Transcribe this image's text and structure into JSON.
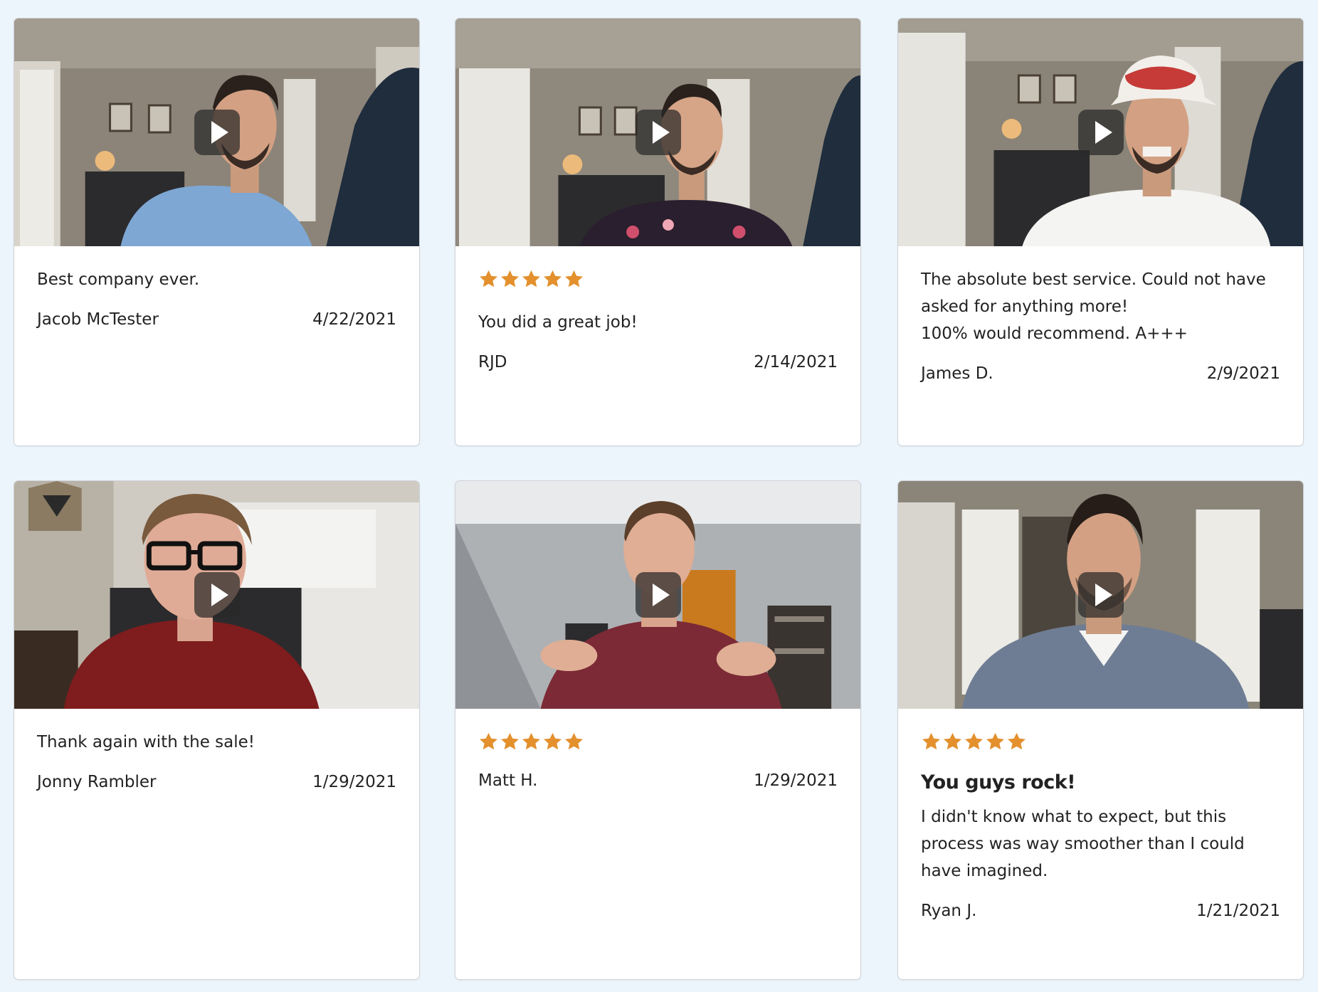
{
  "accent_color": "#e3902d",
  "testimonials": [
    {
      "text": "Best company ever.",
      "author": "Jacob McTester",
      "date": "4/22/2021"
    },
    {
      "rating": 5,
      "text": "You did a great job!",
      "author": "RJD",
      "date": "2/14/2021"
    },
    {
      "text": "The absolute best service. Could not have asked for anything more!\n100% would recommend. A+++",
      "author": "James D.",
      "date": "2/9/2021"
    },
    {
      "text": "Thank again with the sale!",
      "author": "Jonny Rambler",
      "date": "1/29/2021"
    },
    {
      "rating": 5,
      "author": "Matt H.",
      "date": "1/29/2021"
    },
    {
      "rating": 5,
      "title": "You guys rock!",
      "text": "I didn't know what to expect, but this process was way smoother than I could have imagined.",
      "author": "Ryan J.",
      "date": "1/21/2021"
    }
  ]
}
